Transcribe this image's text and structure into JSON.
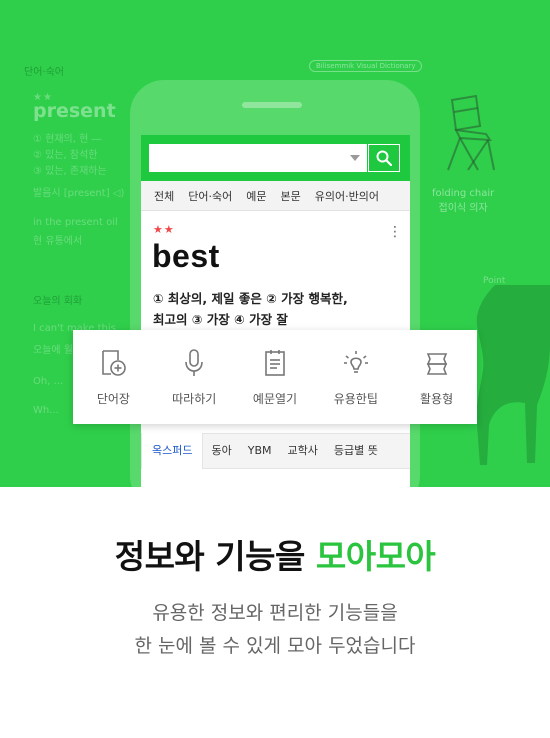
{
  "background_page": {
    "section_label": "단어·숙어",
    "section_sublabel": "",
    "stars": "★★",
    "word": "present",
    "definitions": [
      "① 현재의, 현 ―",
      "② 있는, 참석한",
      "③ 있는, 존재하는"
    ],
    "pronunciation": "발음시 [present] ◁)",
    "example_lines": [
      "in the present oil",
      "현 유통에서"
    ],
    "chat_title": "오늘의 회화",
    "chat_lines": [
      "I can't make this",
      "오늘에 월 ...",
      "Oh, ...",
      "Wh..."
    ],
    "visual_badge": "Bilisemmik Visual Dictionary",
    "chair_label": [
      "folding chair",
      "접이식 의자"
    ],
    "dog_label": "Point"
  },
  "search": {
    "value": "",
    "placeholder": ""
  },
  "tabs": [
    "전체",
    "단어·숙어",
    "예문",
    "본문",
    "유의어·반의어"
  ],
  "entry": {
    "stars": "★★",
    "word": "best",
    "more_icon": "⋮",
    "def_line1": "① 최상의, 제일 좋은   ② 가장 행복한,",
    "def_line2": "최고의   ③ 가장   ④ 가장 잘"
  },
  "features": [
    {
      "label": "단어장",
      "icon": "wordbook-add-icon"
    },
    {
      "label": "따라하기",
      "icon": "microphone-icon"
    },
    {
      "label": "예문열기",
      "icon": "document-list-icon"
    },
    {
      "label": "유용한팁",
      "icon": "lightbulb-icon"
    },
    {
      "label": "활용형",
      "icon": "stack-icon"
    }
  ],
  "dict_tabs": [
    "옥스퍼드",
    "동아",
    "YBM",
    "교학사",
    "등급별 뜻"
  ],
  "headline": {
    "part1": "정보와 기능을 ",
    "accent": "모아모아"
  },
  "subline": {
    "line1": "유용한 정보와 편리한 기능들을",
    "line2": "한 눈에 볼 수 있게 모아 두었습니다"
  },
  "colors": {
    "hero_green": "#2fcf4b",
    "accent_green": "#2bc43f",
    "search_green": "#1ec83f",
    "star_red": "#f04848",
    "active_tab_blue": "#1a55c9"
  }
}
